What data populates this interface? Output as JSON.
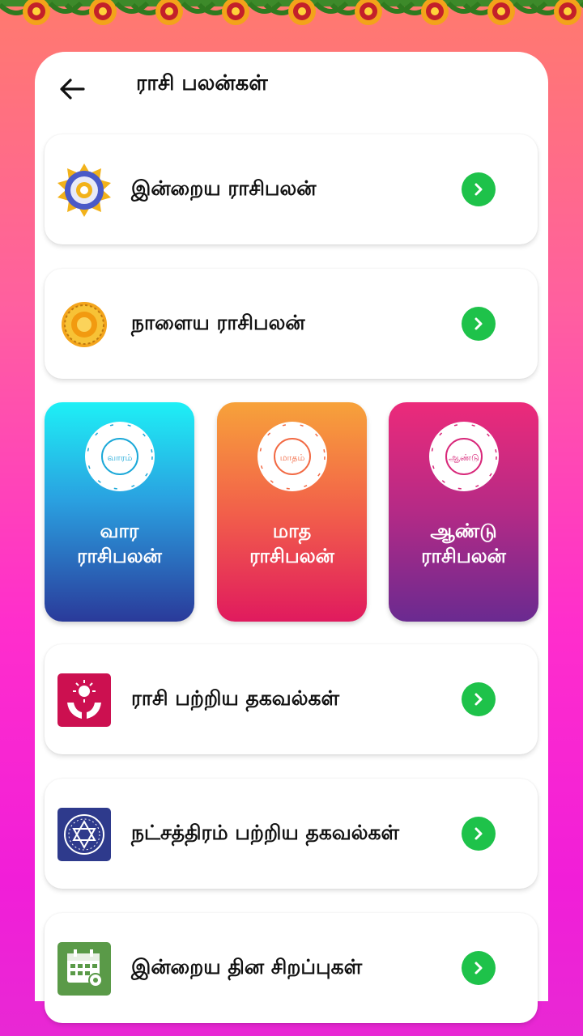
{
  "header": {
    "title": "ராசி பலன்கள்"
  },
  "rows": [
    {
      "label": "இன்றைய ராசிபலன்",
      "icon": "zodiac-wheel-icon"
    },
    {
      "label": "நாளைய ராசிபலன்",
      "icon": "sun-zodiac-icon"
    },
    {
      "label": "ராசி பற்றிய தகவல்கள்",
      "icon": "hands-sun-icon"
    },
    {
      "label": "நட்சத்திரம் பற்றிய தகவல்கள்",
      "icon": "star-chart-icon"
    },
    {
      "label": "இன்றைய தின சிறப்புகள்",
      "icon": "calendar-icon"
    }
  ],
  "tiles": [
    {
      "wheel_text": "வாரம்",
      "line1": "வார",
      "line2": "ராசிபலன்"
    },
    {
      "wheel_text": "மாதம்",
      "line1": "மாத",
      "line2": "ராசிபலன்"
    },
    {
      "wheel_text": "ஆண்டு",
      "line1": "ஆண்டு",
      "line2": "ராசிபலன்"
    }
  ],
  "colors": {
    "go_button": "#1ec24a",
    "tile_weekly": [
      "#1ef0f6",
      "#2a3a9a"
    ],
    "tile_monthly": [
      "#f7a23a",
      "#e01a5e"
    ],
    "tile_yearly": [
      "#e82a80",
      "#6a2a90"
    ]
  }
}
